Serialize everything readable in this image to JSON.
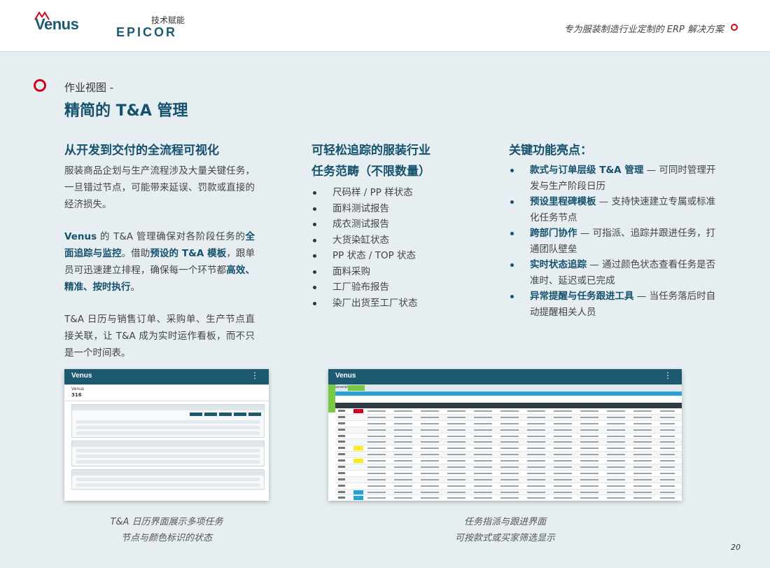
{
  "header": {
    "venus_logo": "Venus",
    "epicor_subtitle": "技术赋能",
    "epicor_logo": "EPICOR",
    "tagline": "专为服装制造行业定制的 ERP 解决方案"
  },
  "section": {
    "kicker": "作业视图 -",
    "title": "精简的 T&A 管理"
  },
  "col1": {
    "heading": "从开发到交付的全流程可视化",
    "p1": "服装商品企划与生产流程涉及大量关键任务，一旦错过节点，可能带来延误、罚款或直接的经济损失。",
    "p2": {
      "t1": "Venus",
      "t2": " 的 T&A 管理确保对各阶段任务的",
      "t3": "全面追踪与监控",
      "t4": "。借助",
      "t5": "预设的 T&A 模板",
      "t6": "，跟单员可迅速建立排程，确保每一个环节都",
      "t7": "高效、精准、按时执行",
      "t8": "。"
    },
    "p3": "T&A 日历与销售订单、采购单、生产节点直接关联，让 T&A 成为实时运作看板，而不只是一个时间表。"
  },
  "col2": {
    "heading_line1": "可轻松追踪的服装行业",
    "heading_line2": "任务范畴（不限数量）",
    "items": [
      "尺码样 / PP 样状态",
      "面料测试报告",
      "成衣测试报告",
      "大货染缸状态",
      "PP 状态 / TOP 状态",
      "面料采购",
      "工厂验布报告",
      "染厂出货至工厂状态"
    ]
  },
  "col3": {
    "heading": "关键功能亮点：",
    "items": [
      {
        "bold": "款式与订单层级 T&A 管理",
        "text": " — 可同时管理开发与生产阶段日历"
      },
      {
        "bold": "预设里程碑模板",
        "text": " — 支持快速建立专属或标准化任务节点"
      },
      {
        "bold": "跨部门协作",
        "text": " — 可指派、追踪并跟进任务，打通团队壁垒"
      },
      {
        "bold": "实时状态追踪",
        "text": " — 通过颜色状态查看任务是否准时、延迟或已完成"
      },
      {
        "bold": "异常提醒与任务跟进工具",
        "text": " — 当任务落后时自动提醒相关人员"
      }
    ]
  },
  "screenshots": {
    "shot1_brand": "Venus",
    "shot1_record_label": "Venus",
    "shot1_record_id": "316",
    "shot2_brand": "Venus",
    "shot2_tab": "General"
  },
  "captions": {
    "cap1_line1": "T&A 日历界面展示多项任务",
    "cap1_line2": "节点与颜色标识的状态",
    "cap2_line1": "任务指派与跟进界面",
    "cap2_line2": "可按款式或买家筛选显示"
  },
  "colors": {
    "brand_teal": "#15526d",
    "accent_red": "#d0021b",
    "status_green": "#7ac943",
    "status_yellow": "#f7ec13",
    "status_blue": "#2aa1d9"
  },
  "page_number": "20"
}
